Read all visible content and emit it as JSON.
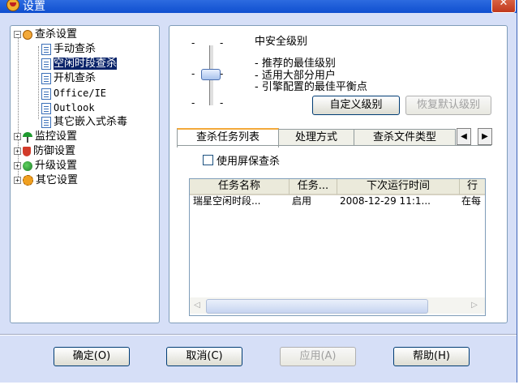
{
  "window": {
    "title": "设置",
    "close_glyph": "✕"
  },
  "tree": {
    "items": [
      {
        "label": "查杀设置",
        "icon": "search-icon",
        "expander": "⊟"
      },
      {
        "label": "手动查杀",
        "icon": "document-icon"
      },
      {
        "label": "空闲时段查杀",
        "icon": "document-icon",
        "selected": true
      },
      {
        "label": "开机查杀",
        "icon": "document-icon"
      },
      {
        "label": "Office/IE",
        "icon": "document-icon"
      },
      {
        "label": "Outlook",
        "icon": "document-icon"
      },
      {
        "label": "其它嵌入式杀毒",
        "icon": "document-icon"
      },
      {
        "label": "监控设置",
        "icon": "umbrella-icon",
        "expander": "⊞"
      },
      {
        "label": "防御设置",
        "icon": "shield-icon",
        "expander": "⊞"
      },
      {
        "label": "升级设置",
        "icon": "globe-icon",
        "expander": "⊞"
      },
      {
        "label": "其它设置",
        "icon": "gear-icon",
        "expander": "⊞"
      }
    ]
  },
  "level": {
    "title": "中安全级别",
    "descriptions": [
      "- 推荐的最佳级别",
      "- 适用大部分用户",
      "- 引擎配置的最佳平衡点"
    ],
    "slider_tick": "-",
    "custom_button": "自定义级别",
    "restore_button": "恢复默认级别"
  },
  "tabs": {
    "items": [
      "查杀任务列表",
      "处理方式",
      "查杀文件类型"
    ],
    "active": 0,
    "prev_glyph": "◀",
    "next_glyph": "▶"
  },
  "screensaver": {
    "label": "使用屏保查杀",
    "checked": false
  },
  "task_list": {
    "columns": [
      "任务名称",
      "任务...",
      "下次运行时间",
      "行"
    ],
    "rows": [
      [
        "瑞星空闲时段...",
        "启用",
        "2008-12-29 11:1...",
        "在每"
      ]
    ]
  },
  "buttons": {
    "ok": "确定(O)",
    "cancel": "取消(C)",
    "apply": "应用(A)",
    "help": "帮助(H)"
  },
  "colors": {
    "titlebar": "#0f4fd0",
    "window_bg": "#d6dff7",
    "selection": "#0a246a",
    "tab_accent": "#f3a93a"
  }
}
